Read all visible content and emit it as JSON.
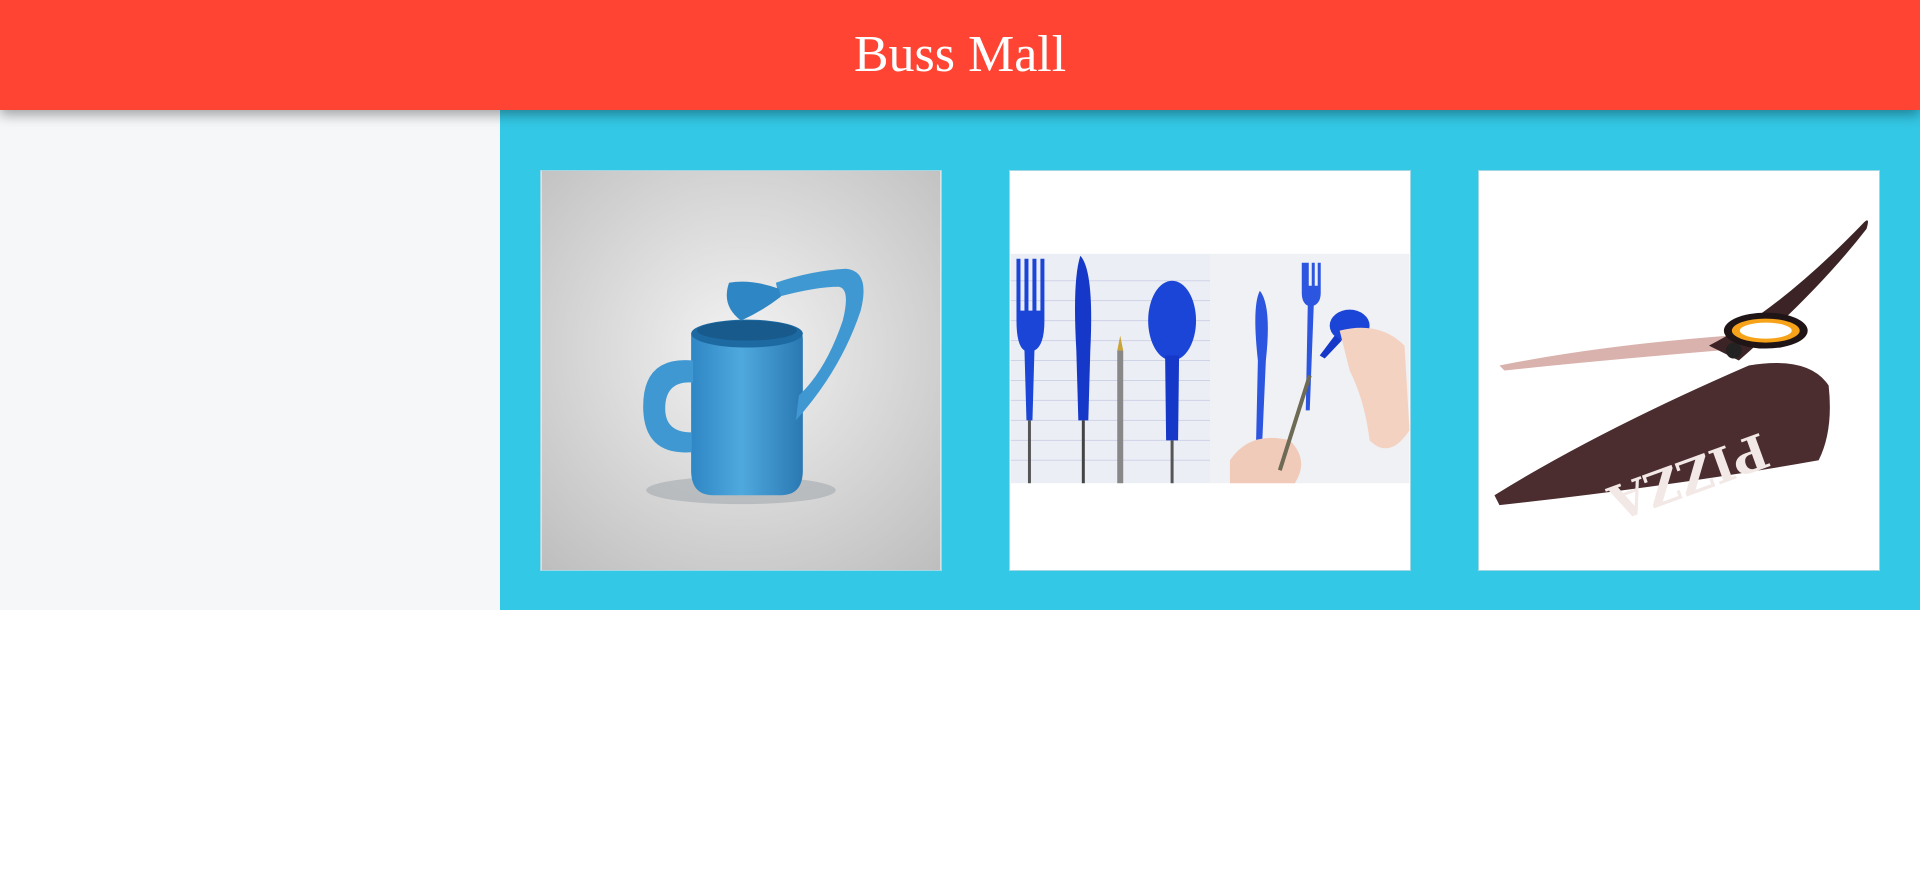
{
  "header": {
    "title": "Buss Mall",
    "background_color": "#ff4433",
    "text_color": "#ffffff"
  },
  "sidebar": {
    "background_color": "#f6f7f9"
  },
  "main": {
    "background_color": "#33c8e6",
    "products": [
      {
        "icon": "watering-can-image"
      },
      {
        "icon": "pen-utensils-image"
      },
      {
        "icon": "pizza-scissors-image"
      }
    ]
  }
}
